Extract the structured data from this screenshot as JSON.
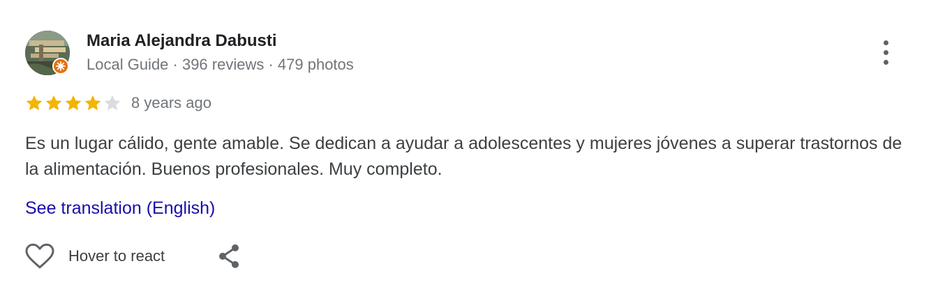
{
  "author": {
    "name": "Maria Alejandra Dabusti",
    "meta": "Local Guide · 396 reviews · 479 photos",
    "avatar_icon": "profile-photo",
    "badge_icon": "local-guide-badge-icon",
    "badge_color": "#e8710a"
  },
  "rating": {
    "value": 4,
    "max": 5,
    "filled_color": "#f4b400",
    "empty_color": "#dadce0"
  },
  "review": {
    "date": "8 years ago",
    "text": "Es un lugar cálido, gente amable. Se dedican a ayudar a adolescentes y mujeres jóvenes a superar trastornos de la alimentación. Buenos profesionales. Muy completo.",
    "translate_label": "See translation (English)"
  },
  "actions": {
    "react_label": "Hover to react",
    "react_icon": "heart-outline-icon",
    "share_icon": "share-icon",
    "more_icon": "more-vertical-icon"
  },
  "colors": {
    "link": "#1a0dab",
    "text": "#3c4043",
    "secondary": "#70757a"
  }
}
